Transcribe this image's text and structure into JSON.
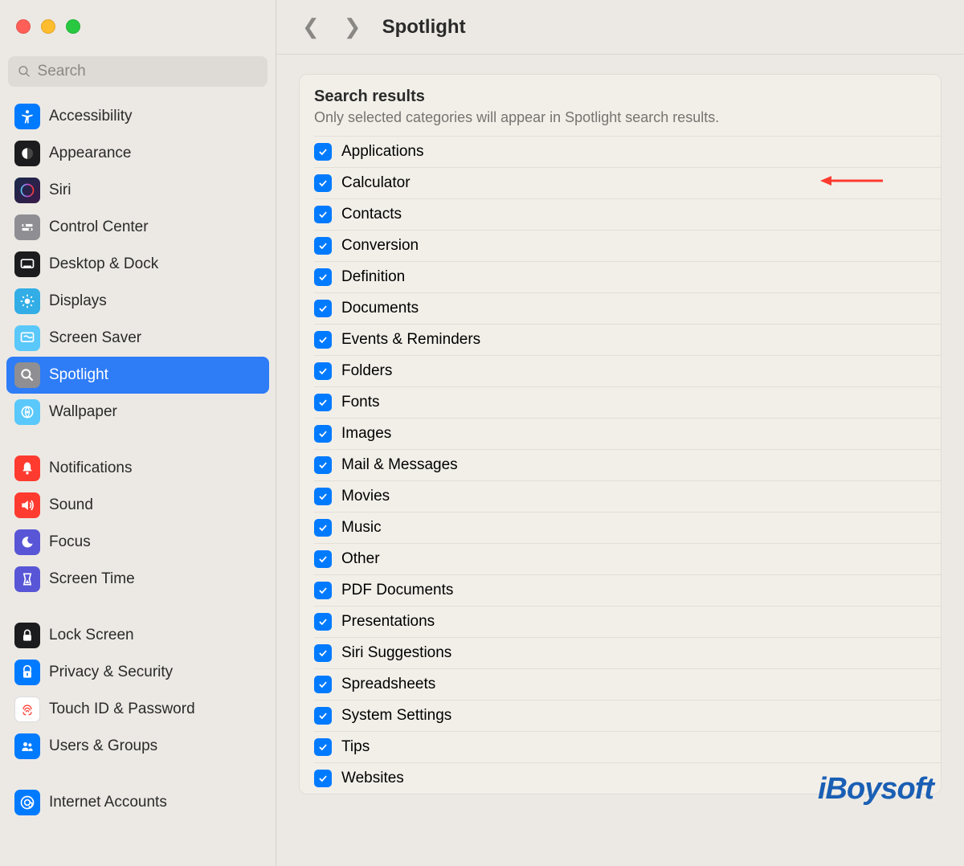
{
  "window": {
    "close": "Close",
    "minimize": "Minimize",
    "zoom": "Zoom"
  },
  "search": {
    "placeholder": "Search"
  },
  "header": {
    "title": "Spotlight",
    "back": "Back",
    "forward": "Forward"
  },
  "sidebar": {
    "items": [
      {
        "label": "Accessibility",
        "icon": "accessibility-icon",
        "bg": "#007aff"
      },
      {
        "label": "Appearance",
        "icon": "appearance-icon",
        "bg": "#1c1c1e"
      },
      {
        "label": "Siri",
        "icon": "siri-icon",
        "bg": "linear-gradient(135deg,#1a2a4a,#3a1a4a)"
      },
      {
        "label": "Control Center",
        "icon": "control-center-icon",
        "bg": "#8e8e93"
      },
      {
        "label": "Desktop & Dock",
        "icon": "desktop-dock-icon",
        "bg": "#1c1c1e"
      },
      {
        "label": "Displays",
        "icon": "displays-icon",
        "bg": "#32ade6"
      },
      {
        "label": "Screen Saver",
        "icon": "screen-saver-icon",
        "bg": "#5ac8fa"
      },
      {
        "label": "Spotlight",
        "icon": "spotlight-icon",
        "bg": "#8e8e93",
        "selected": true
      },
      {
        "label": "Wallpaper",
        "icon": "wallpaper-icon",
        "bg": "#5ac8fa"
      }
    ],
    "group2": [
      {
        "label": "Notifications",
        "icon": "notifications-icon",
        "bg": "#ff3b30"
      },
      {
        "label": "Sound",
        "icon": "sound-icon",
        "bg": "#ff3b30"
      },
      {
        "label": "Focus",
        "icon": "focus-icon",
        "bg": "#5856d6"
      },
      {
        "label": "Screen Time",
        "icon": "screen-time-icon",
        "bg": "#5856d6"
      }
    ],
    "group3": [
      {
        "label": "Lock Screen",
        "icon": "lock-screen-icon",
        "bg": "#1c1c1e"
      },
      {
        "label": "Privacy & Security",
        "icon": "privacy-icon",
        "bg": "#007aff"
      },
      {
        "label": "Touch ID & Password",
        "icon": "touchid-icon",
        "bg": "#ffffff"
      },
      {
        "label": "Users & Groups",
        "icon": "users-icon",
        "bg": "#007aff"
      }
    ],
    "group4": [
      {
        "label": "Internet Accounts",
        "icon": "internet-accounts-icon",
        "bg": "#007aff"
      }
    ]
  },
  "panel": {
    "title": "Search results",
    "subtitle": "Only selected categories will appear in Spotlight search results."
  },
  "categories": [
    "Applications",
    "Calculator",
    "Contacts",
    "Conversion",
    "Definition",
    "Documents",
    "Events & Reminders",
    "Folders",
    "Fonts",
    "Images",
    "Mail & Messages",
    "Movies",
    "Music",
    "Other",
    "PDF Documents",
    "Presentations",
    "Siri Suggestions",
    "Spreadsheets",
    "System Settings",
    "Tips",
    "Websites"
  ],
  "watermark": "iBoysoft"
}
